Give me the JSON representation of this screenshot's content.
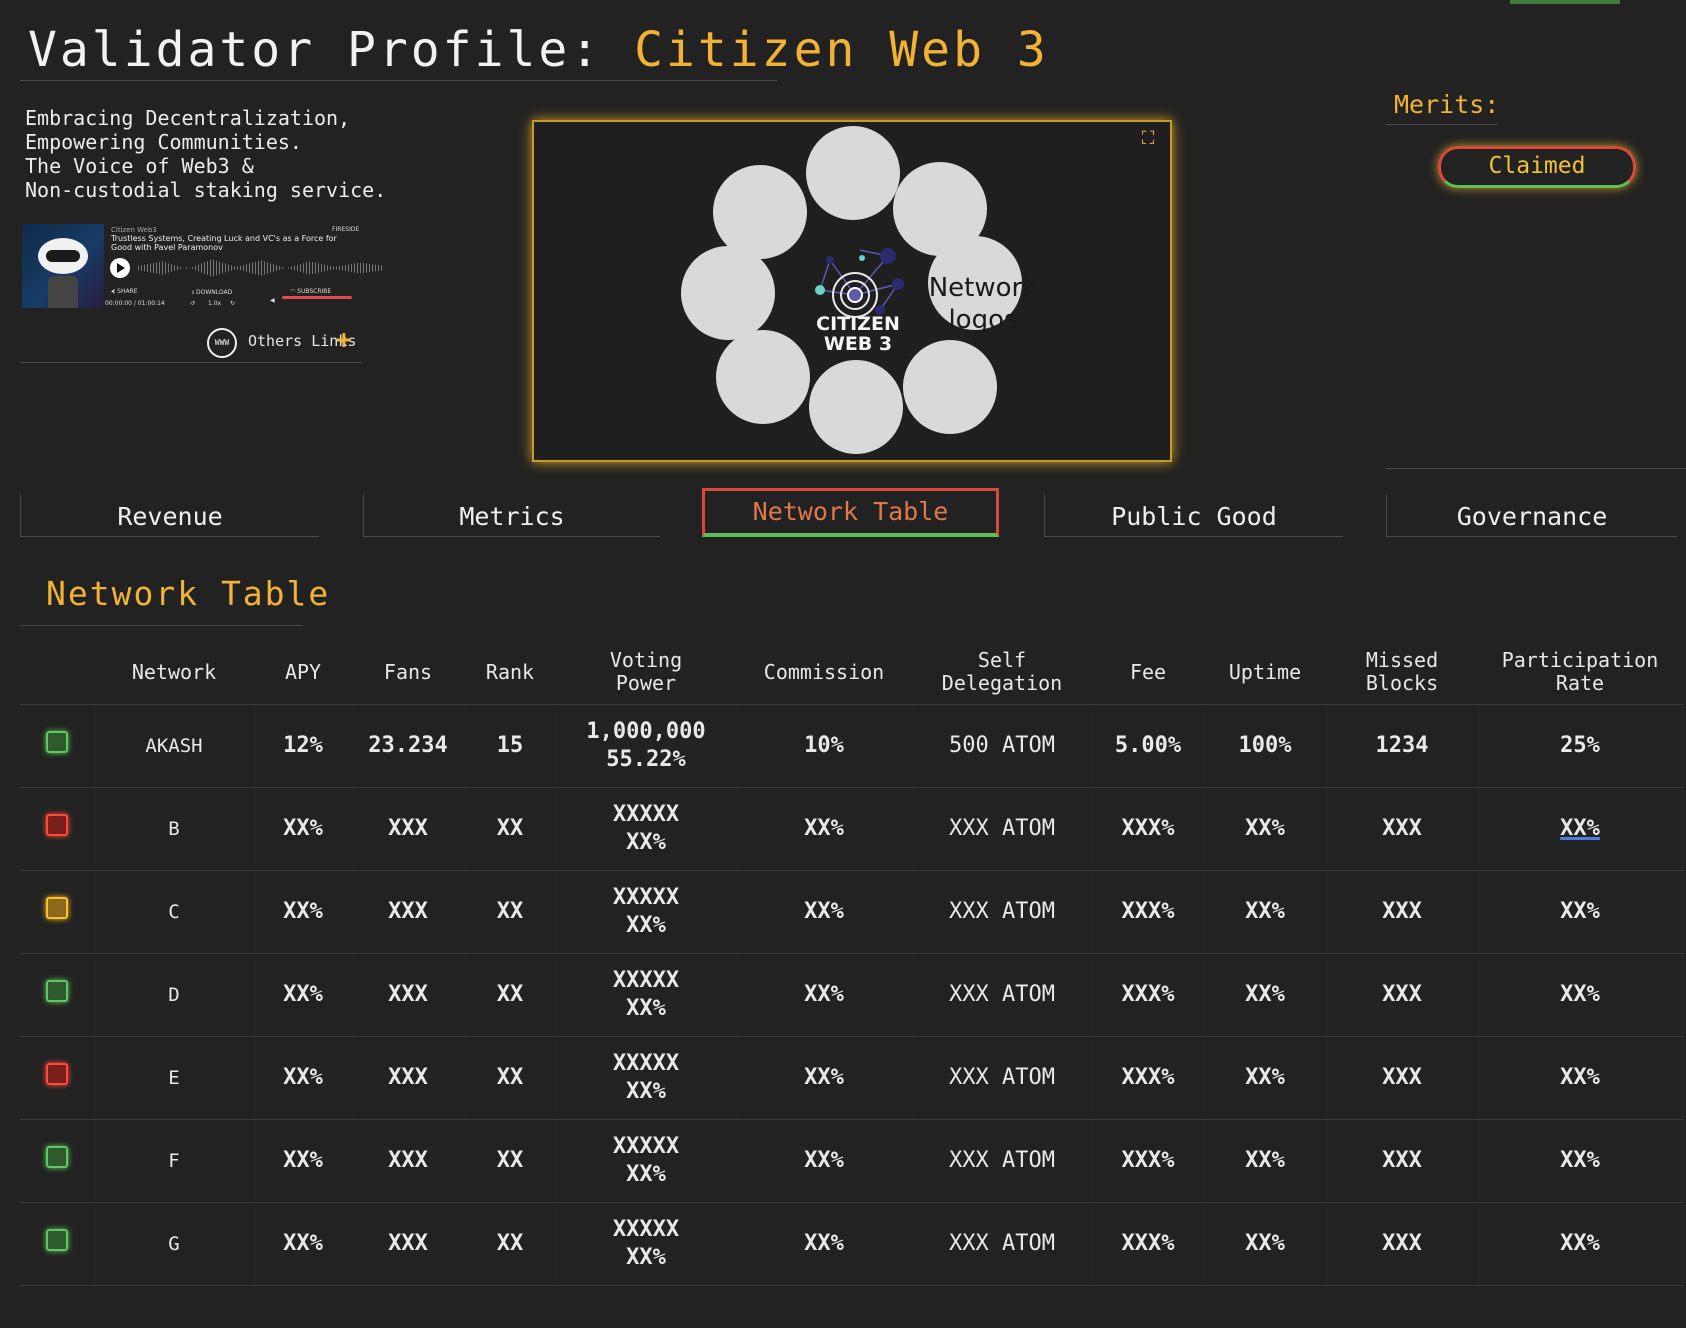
{
  "page": {
    "title_prefix": "Validator Profile:",
    "title_name": "Citizen Web 3"
  },
  "tagline": [
    "Embracing Decentralization,",
    "Empowering Communities.",
    "The Voice of Web3 &",
    "Non-custodial staking service."
  ],
  "podcast": {
    "show": "Citizen Web3",
    "brand": "FIRESIDE",
    "episode_title": "Trustless Systems, Creating Luck and VC's as a Force for Good with Pavel Paramonov",
    "share": "SHARE",
    "download": "DOWNLOAD",
    "subscribe": "SUBSCRIBE",
    "time": "00:00:00 / 01:00:14",
    "speed": "1.0x"
  },
  "links": {
    "www_label": "WWW",
    "others_label": "Others Links",
    "add_icon": "+"
  },
  "logo_panel": {
    "caption": "Network logos",
    "center_logo_text": "CITIZEN WEB 3",
    "expand_icon": "expand-icon"
  },
  "merits": {
    "label": "Merits:",
    "badge": "Claimed"
  },
  "tabs": [
    {
      "label": "Revenue",
      "active": false
    },
    {
      "label": "Metrics",
      "active": false
    },
    {
      "label": "Network Table",
      "active": true
    },
    {
      "label": "Public Good",
      "active": false
    },
    {
      "label": "Governance",
      "active": false
    }
  ],
  "section_title": "Network Table",
  "table": {
    "headers": {
      "network": "Network",
      "apy": "APY",
      "fans": "Fans",
      "rank": "Rank",
      "voting_power_1": "Voting",
      "voting_power_2": "Power",
      "commission": "Commission",
      "self_delegation_1": "Self",
      "self_delegation_2": "Delegation",
      "fee": "Fee",
      "uptime": "Uptime",
      "missed_blocks_1": "Missed",
      "missed_blocks_2": "Blocks",
      "participation_1": "Participation",
      "participation_2": "Rate"
    },
    "rows": [
      {
        "status": "green",
        "network": "AKASH",
        "apy": "12%",
        "fans": "23.234",
        "rank": "15",
        "vp1": "1,000,000",
        "vp2": "55.22%",
        "commission": "10%",
        "self": "500 ATOM",
        "fee": "5.00%",
        "uptime": "100%",
        "missed": "1234",
        "participation": "25%"
      },
      {
        "status": "red",
        "network": "B",
        "apy": "XX%",
        "fans": "XXX",
        "rank": "XX",
        "vp1": "XXXXX",
        "vp2": "XX%",
        "commission": "XX%",
        "self": "XXX ATOM",
        "fee": "XXX%",
        "uptime": "XX%",
        "missed": "XXX",
        "participation": "XX%"
      },
      {
        "status": "yellow",
        "network": "C",
        "apy": "XX%",
        "fans": "XXX",
        "rank": "XX",
        "vp1": "XXXXX",
        "vp2": "XX%",
        "commission": "XX%",
        "self": "XXX ATOM",
        "fee": "XXX%",
        "uptime": "XX%",
        "missed": "XXX",
        "participation": "XX%"
      },
      {
        "status": "green",
        "network": "D",
        "apy": "XX%",
        "fans": "XXX",
        "rank": "XX",
        "vp1": "XXXXX",
        "vp2": "XX%",
        "commission": "XX%",
        "self": "XXX ATOM",
        "fee": "XXX%",
        "uptime": "XX%",
        "missed": "XXX",
        "participation": "XX%"
      },
      {
        "status": "red",
        "network": "E",
        "apy": "XX%",
        "fans": "XXX",
        "rank": "XX",
        "vp1": "XXXXX",
        "vp2": "XX%",
        "commission": "XX%",
        "self": "XXX ATOM",
        "fee": "XXX%",
        "uptime": "XX%",
        "missed": "XXX",
        "participation": "XX%"
      },
      {
        "status": "green",
        "network": "F",
        "apy": "XX%",
        "fans": "XXX",
        "rank": "XX",
        "vp1": "XXXXX",
        "vp2": "XX%",
        "commission": "XX%",
        "self": "XXX ATOM",
        "fee": "XXX%",
        "uptime": "XX%",
        "missed": "XXX",
        "participation": "XX%"
      },
      {
        "status": "green",
        "network": "G",
        "apy": "XX%",
        "fans": "XXX",
        "rank": "XX",
        "vp1": "XXXXX",
        "vp2": "XX%",
        "commission": "XX%",
        "self": "XXX ATOM",
        "fee": "XXX%",
        "uptime": "XX%",
        "missed": "XXX",
        "participation": "XX%"
      }
    ]
  },
  "colors": {
    "accent": "#f2b233",
    "background": "#222222",
    "status_green": "#5fc75f",
    "status_red": "#ff4a3a",
    "status_yellow": "#ffbf2a"
  }
}
